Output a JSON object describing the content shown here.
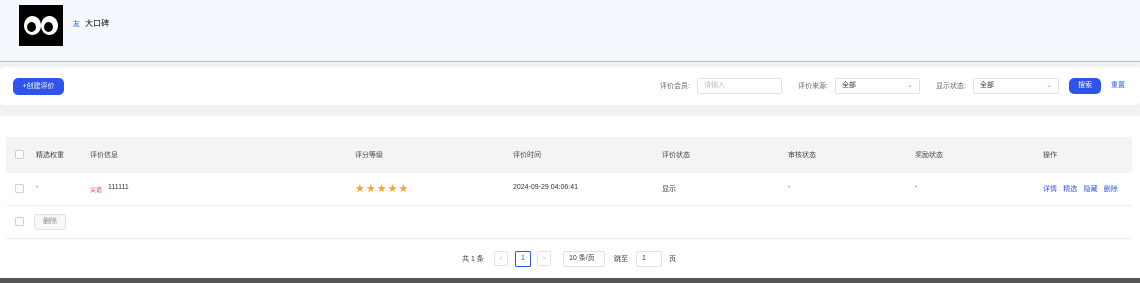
{
  "header": {
    "brand_tag": "友",
    "brand_name": "大口碑"
  },
  "filters": {
    "create_button": "+创建评价",
    "member_label": "评价会员:",
    "member_placeholder": "请输入",
    "source_label": "评价来源:",
    "source_value": "全部",
    "status_label": "显示状态:",
    "status_value": "全部",
    "search_button": "搜索",
    "reset_link": "重置"
  },
  "table": {
    "columns": [
      "精选权重",
      "评价信息",
      "评分等级",
      "评价时间",
      "评价状态",
      "审核状态",
      "奖励状态",
      "操作"
    ],
    "rows": [
      {
        "weight": "-",
        "tag": "尖追",
        "info": "111111",
        "rating": 5,
        "stars": "★★★★★",
        "time": "2024-09-29 04:06:41",
        "status": "显示",
        "review_status": "-",
        "reward_status": "-",
        "actions": [
          "详情",
          "精选",
          "隐藏",
          "删除"
        ]
      }
    ],
    "bulk_delete_button": "删除"
  },
  "pagination": {
    "total_text": "共 1 条",
    "prev_icon": "‹",
    "current_page": "1",
    "next_icon": "›",
    "page_size": "10 条/页",
    "goto_label": "跳至",
    "goto_value": "1",
    "page_suffix": "页"
  },
  "colors": {
    "accent": "#2f54eb",
    "star": "#f5a623",
    "tag_red": "#e4393c"
  }
}
